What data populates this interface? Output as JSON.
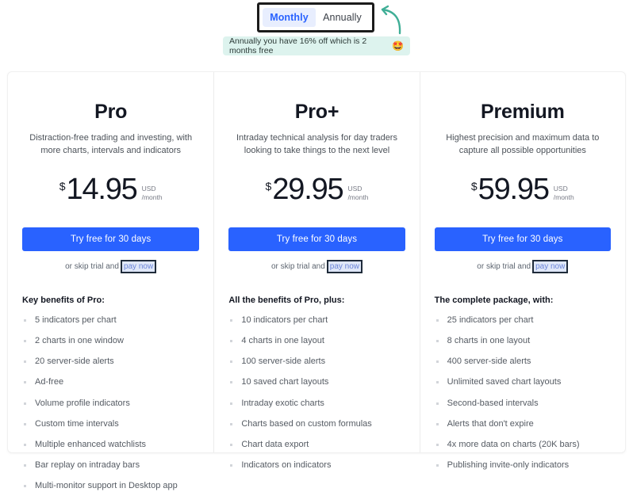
{
  "billing_toggle": {
    "options": [
      {
        "label": "Monthly",
        "active": true
      },
      {
        "label": "Annually",
        "active": false
      }
    ],
    "arrow_icon": "curved-arrow-icon"
  },
  "discount_banner": {
    "text": "Annually you have 16% off which is 2 months free",
    "emoji": "🤩",
    "emoji_name": "star-struck-emoji",
    "background_color": "#ddf3ee"
  },
  "accent_color": "#2962ff",
  "plans": [
    {
      "name": "Pro",
      "description": "Distraction-free trading and investing, with more charts, intervals and indicators",
      "currency_symbol": "$",
      "price": "14.95",
      "currency_code": "USD",
      "period": "/month",
      "cta_label": "Try free for 30 days",
      "skip_text": "or skip trial and",
      "pay_now_label": "pay now",
      "benefits_title": "Key benefits of Pro:",
      "benefits": [
        "5 indicators per chart",
        "2 charts in one window",
        "20 server-side alerts",
        "Ad-free",
        "Volume profile indicators",
        "Custom time intervals",
        "Multiple enhanced watchlists",
        "Bar replay on intraday bars",
        "Multi-monitor support in Desktop app"
      ]
    },
    {
      "name": "Pro+",
      "description": "Intraday technical analysis for day traders looking to take things to the next level",
      "currency_symbol": "$",
      "price": "29.95",
      "currency_code": "USD",
      "period": "/month",
      "cta_label": "Try free for 30 days",
      "skip_text": "or skip trial and",
      "pay_now_label": "pay now",
      "benefits_title": "All the benefits of Pro, plus:",
      "benefits": [
        "10 indicators per chart",
        "4 charts in one layout",
        "100 server-side alerts",
        "10 saved chart layouts",
        "Intraday exotic charts",
        "Charts based on custom formulas",
        "Chart data export",
        "Indicators on indicators"
      ]
    },
    {
      "name": "Premium",
      "description": "Highest precision and maximum data to capture all possible opportunities",
      "currency_symbol": "$",
      "price": "59.95",
      "currency_code": "USD",
      "period": "/month",
      "cta_label": "Try free for 30 days",
      "skip_text": "or skip trial and",
      "pay_now_label": "pay now",
      "benefits_title": "The complete package, with:",
      "benefits": [
        "25 indicators per chart",
        "8 charts in one layout",
        "400 server-side alerts",
        "Unlimited saved chart layouts",
        "Second-based intervals",
        "Alerts that don't expire",
        "4x more data on charts (20K bars)",
        "Publishing invite-only indicators"
      ]
    }
  ]
}
